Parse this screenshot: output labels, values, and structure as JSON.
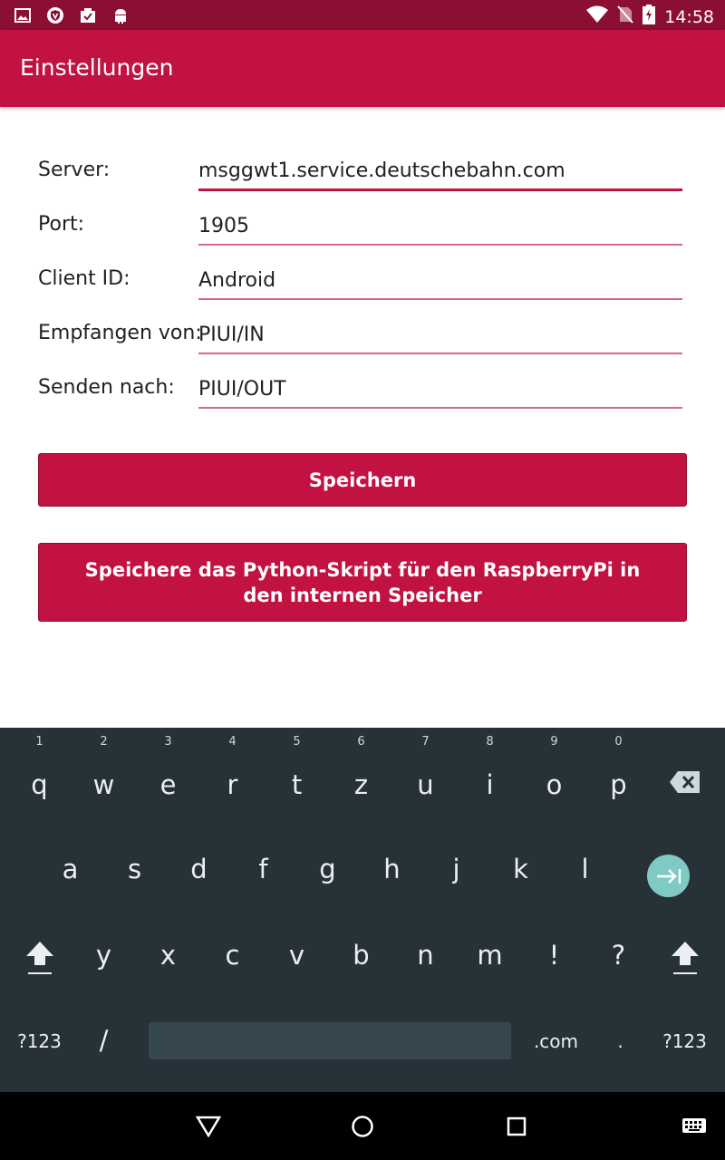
{
  "status_bar": {
    "time": "14:58",
    "left_icons": [
      "image-icon",
      "shield-v-icon",
      "clipboard-check-icon",
      "android-icon"
    ],
    "right_icons": [
      "wifi-icon",
      "no-sim-icon",
      "battery-charging-icon"
    ]
  },
  "app_bar": {
    "title": "Einstellungen"
  },
  "form": {
    "server_label": "Server:",
    "server_value": "msggwt1.service.deutschebahn.com",
    "port_label": "Port:",
    "port_value": "1905",
    "client_label": "Client ID:",
    "client_value": "Android",
    "receive_label": "Empfangen von:",
    "receive_value": "PIUI/IN",
    "send_label": "Senden nach:",
    "send_value": "PIUI/OUT"
  },
  "buttons": {
    "save": "Speichern",
    "save_script": "Speichere das Python-Skript für den RaspberryPi in den internen Speicher"
  },
  "keyboard": {
    "row1": [
      "q",
      "w",
      "e",
      "r",
      "t",
      "z",
      "u",
      "i",
      "o",
      "p"
    ],
    "row1_hints": [
      "1",
      "2",
      "3",
      "4",
      "5",
      "6",
      "7",
      "8",
      "9",
      "0"
    ],
    "row2": [
      "a",
      "s",
      "d",
      "f",
      "g",
      "h",
      "j",
      "k",
      "l"
    ],
    "row3": [
      "y",
      "x",
      "c",
      "v",
      "b",
      "n",
      "m",
      "!",
      "?"
    ],
    "symbols_left": "?123",
    "slash": "/",
    "dotcom": ".com",
    "period": ".",
    "symbols_right": "?123"
  },
  "colors": {
    "primary": "#c11241",
    "primary_dark": "#8b0e33",
    "keyboard_bg": "#263238",
    "enter_key": "#7fcbc4"
  }
}
